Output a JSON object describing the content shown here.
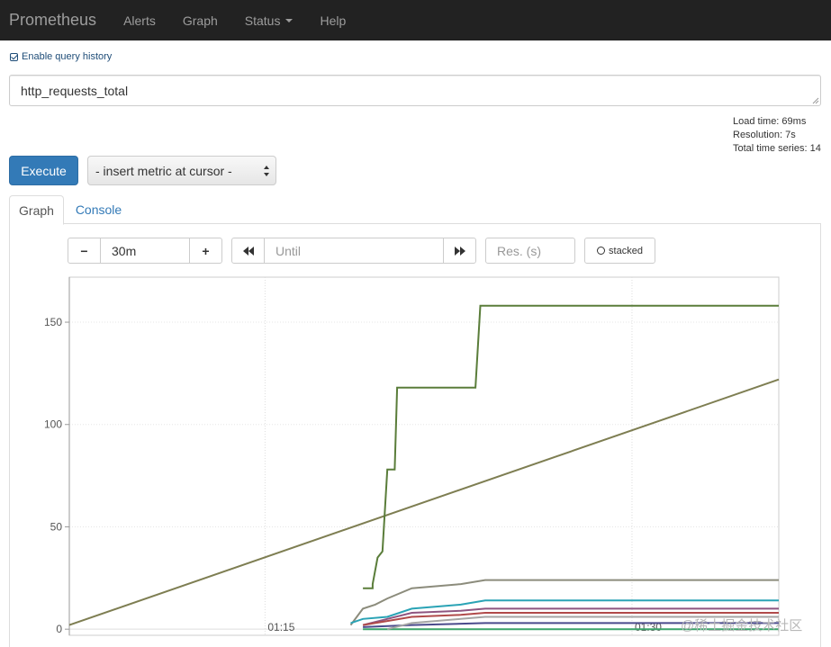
{
  "navbar": {
    "brand": "Prometheus",
    "items": [
      {
        "label": "Alerts"
      },
      {
        "label": "Graph"
      },
      {
        "label": "Status"
      },
      {
        "label": "Help"
      }
    ]
  },
  "query": {
    "history_label": "Enable query history",
    "expression": "http_requests_total"
  },
  "stats": {
    "load_time": "Load time: 69ms",
    "resolution": "Resolution: 7s",
    "total_series": "Total time series: 14"
  },
  "toolbar": {
    "execute_label": "Execute",
    "metric_select": "- insert metric at cursor -"
  },
  "tabs": [
    {
      "label": "Graph",
      "active": true
    },
    {
      "label": "Console",
      "active": false
    }
  ],
  "graph_controls": {
    "range_minus": "−",
    "range_value": "30m",
    "range_plus": "+",
    "until_placeholder": "Until",
    "resolution_placeholder": "Res. (s)",
    "stacked_label": "stacked"
  },
  "watermark": "@稀土掘金技术社区",
  "chart_data": {
    "type": "line",
    "x_axis": {
      "ticks": [
        "01:15",
        "01:30"
      ],
      "range": [
        "01:07",
        "01:36"
      ]
    },
    "y_axis": {
      "ticks": [
        0,
        50,
        100,
        150
      ],
      "range": [
        -3,
        172
      ]
    },
    "grid": true,
    "series": [
      {
        "color": "#7e7e52",
        "points": [
          [
            "01:07",
            2
          ],
          [
            "01:36",
            122
          ]
        ]
      },
      {
        "color": "#5a7d3a",
        "points": [
          [
            "01:19",
            20
          ],
          [
            "01:19.4",
            20
          ],
          [
            "01:19.4",
            22
          ],
          [
            "01:19.6",
            35
          ],
          [
            "01:19.8",
            38
          ],
          [
            "01:20",
            78
          ],
          [
            "01:20.3",
            78
          ],
          [
            "01:20.4",
            118
          ],
          [
            "01:23.6",
            118
          ],
          [
            "01:23.8",
            158
          ],
          [
            "01:36",
            158
          ]
        ]
      },
      {
        "color": "#8c8c7c",
        "points": [
          [
            "01:18.5",
            2
          ],
          [
            "01:19",
            10
          ],
          [
            "01:19.5",
            12
          ],
          [
            "01:20",
            15
          ],
          [
            "01:21",
            20
          ],
          [
            "01:23",
            22
          ],
          [
            "01:24",
            24
          ],
          [
            "01:36",
            24
          ]
        ]
      },
      {
        "color": "#2aa3b5",
        "points": [
          [
            "01:18.5",
            3
          ],
          [
            "01:19",
            5
          ],
          [
            "01:20",
            6
          ],
          [
            "01:21",
            10
          ],
          [
            "01:23",
            12
          ],
          [
            "01:24",
            14
          ],
          [
            "01:36",
            14
          ]
        ]
      },
      {
        "color": "#8e5580",
        "points": [
          [
            "01:19",
            2
          ],
          [
            "01:20",
            5
          ],
          [
            "01:21",
            8
          ],
          [
            "01:23",
            9
          ],
          [
            "01:24",
            10
          ],
          [
            "01:36",
            10
          ]
        ]
      },
      {
        "color": "#b04a4a",
        "points": [
          [
            "01:19",
            2
          ],
          [
            "01:20",
            4
          ],
          [
            "01:21",
            6
          ],
          [
            "01:23",
            7
          ],
          [
            "01:24",
            8
          ],
          [
            "01:36",
            8
          ]
        ]
      },
      {
        "color": "#4a4a8c",
        "points": [
          [
            "01:19",
            1
          ],
          [
            "01:21",
            2
          ],
          [
            "01:24",
            3
          ],
          [
            "01:36",
            3
          ]
        ]
      },
      {
        "color": "#3aa36a",
        "points": [
          [
            "01:19",
            0
          ],
          [
            "01:36",
            0
          ]
        ]
      },
      {
        "color": "#a5a5a5",
        "points": [
          [
            "01:20",
            0
          ],
          [
            "01:21",
            3
          ],
          [
            "01:23",
            5
          ],
          [
            "01:24",
            6
          ],
          [
            "01:36",
            6
          ]
        ]
      }
    ]
  }
}
